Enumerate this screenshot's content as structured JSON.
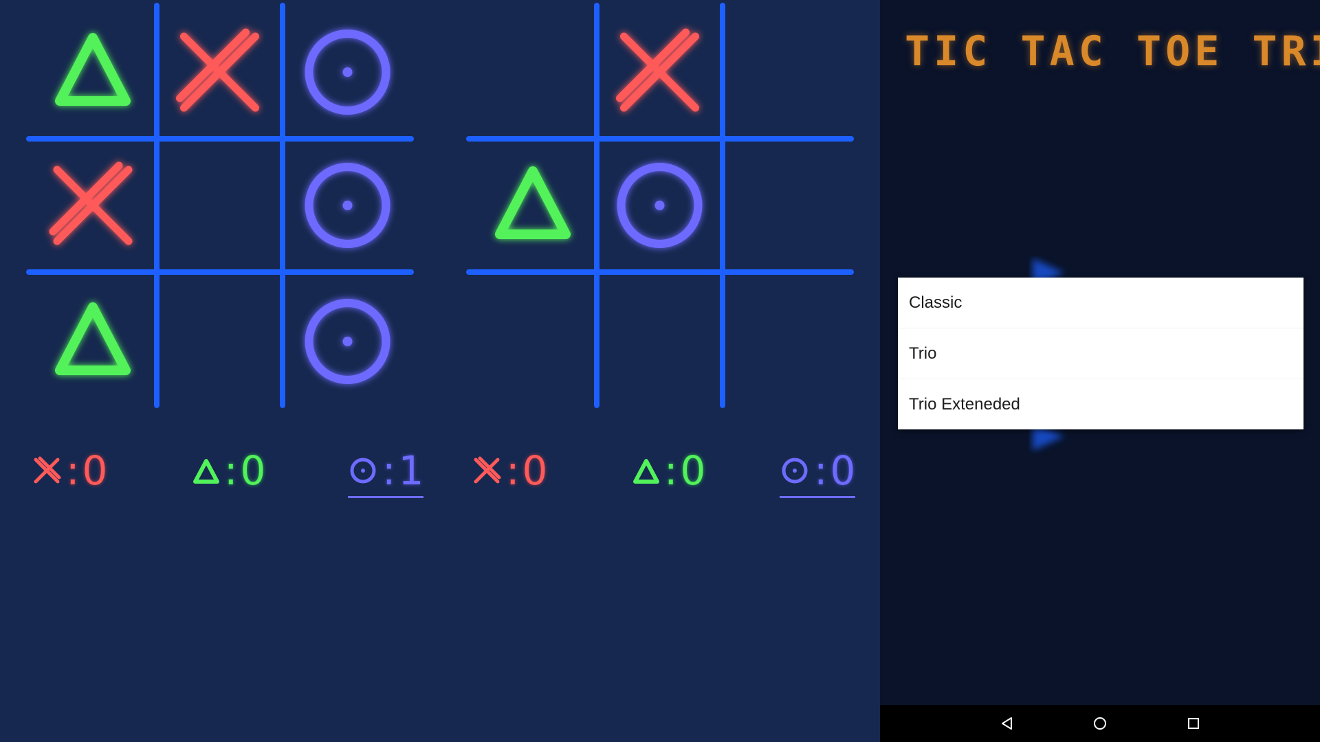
{
  "app": {
    "title": "TIC TAC TOE TRIO"
  },
  "colors": {
    "background": "#16284f",
    "grid": "#1e60ff",
    "x_mark": "#ff5a5a",
    "triangle_mark": "#52f25a",
    "o_mark": "#6e6bff",
    "title": "#d9892a",
    "side_panel": "#0a132a"
  },
  "boards": [
    {
      "cells": [
        "triangle",
        "x",
        "o",
        "x",
        "",
        "o",
        "triangle",
        "",
        "o"
      ]
    },
    {
      "cells": [
        "",
        "x",
        "",
        "triangle",
        "o",
        "",
        "",
        "",
        ""
      ]
    }
  ],
  "scores": [
    {
      "x": "0",
      "triangle": "0",
      "o": "1"
    },
    {
      "x": "0",
      "triangle": "0",
      "o": "0"
    }
  ],
  "menu": {
    "items": [
      "Classic",
      "Trio",
      "Trio Exteneded"
    ]
  },
  "navbar": {
    "icons": [
      "back-icon",
      "home-icon",
      "recents-icon"
    ]
  }
}
